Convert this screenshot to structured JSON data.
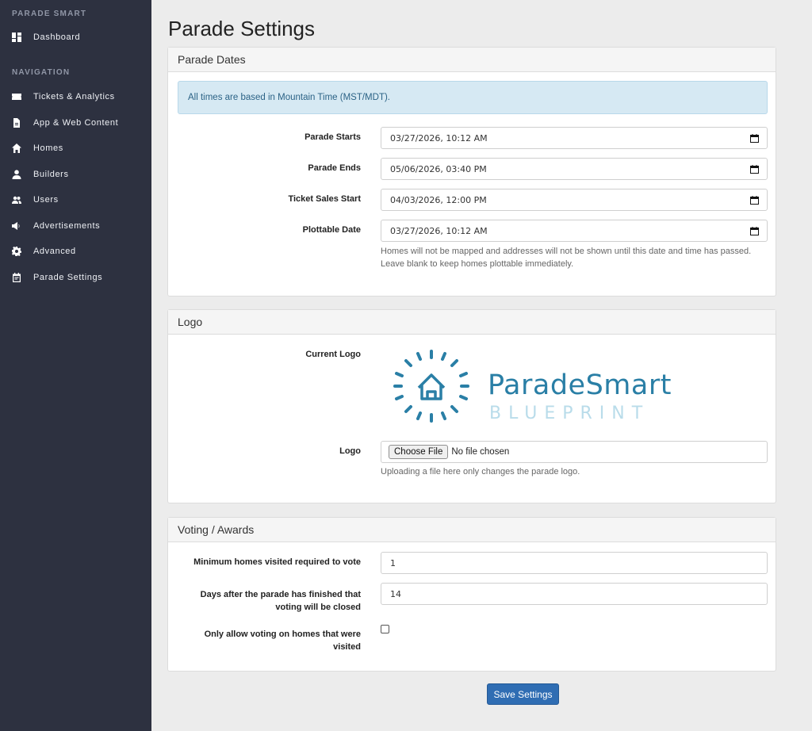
{
  "sidebar": {
    "brand": "PARADE SMART",
    "dashboard": "Dashboard",
    "nav_header": "NAVIGATION",
    "items": [
      {
        "label": "Tickets & Analytics",
        "icon": "ticket-icon"
      },
      {
        "label": "App & Web Content",
        "icon": "document-icon"
      },
      {
        "label": "Homes",
        "icon": "home-icon"
      },
      {
        "label": "Builders",
        "icon": "person-icon"
      },
      {
        "label": "Users",
        "icon": "people-icon"
      },
      {
        "label": "Advertisements",
        "icon": "megaphone-icon"
      },
      {
        "label": "Advanced",
        "icon": "gear-icon"
      },
      {
        "label": "Parade Settings",
        "icon": "calendar-icon"
      }
    ]
  },
  "page": {
    "title": "Parade Settings"
  },
  "dates_panel": {
    "title": "Parade Dates",
    "alert": "All times are based in Mountain Time (MST/MDT).",
    "fields": [
      {
        "label": "Parade Starts",
        "value": "03/27/2026, 10:12 AM"
      },
      {
        "label": "Parade Ends",
        "value": "05/06/2026, 03:40 PM"
      },
      {
        "label": "Ticket Sales Start",
        "value": "04/03/2026, 12:00 PM"
      },
      {
        "label": "Plottable Date",
        "value": "03/27/2026, 10:12 AM"
      }
    ],
    "plottable_help": "Homes will not be mapped and addresses will not be shown until this date and time has passed. Leave blank to keep homes plottable immediately."
  },
  "logo_panel": {
    "title": "Logo",
    "current_label": "Current Logo",
    "logo_brand": "ParadeSmart",
    "logo_sub": "BLUEPRINT",
    "file_label": "Logo",
    "file_button": "Choose File",
    "file_status": "No file chosen",
    "help": "Uploading a file here only changes the parade logo."
  },
  "voting_panel": {
    "title": "Voting / Awards",
    "min_homes_label": "Minimum homes visited required to vote",
    "min_homes_value": "1",
    "days_label_1": "Days after the parade has finished that",
    "days_label_2": "voting will be closed",
    "days_value": "14",
    "only_visited_label_1": "Only allow voting on homes that were",
    "only_visited_label_2": "visited",
    "only_visited_checked": false
  },
  "actions": {
    "save": "Save Settings"
  },
  "colors": {
    "sidebar_bg": "#2d3140",
    "primary": "#2f6db3",
    "alert_bg": "#d6e9f3",
    "logo_blue": "#2a7fa6"
  }
}
